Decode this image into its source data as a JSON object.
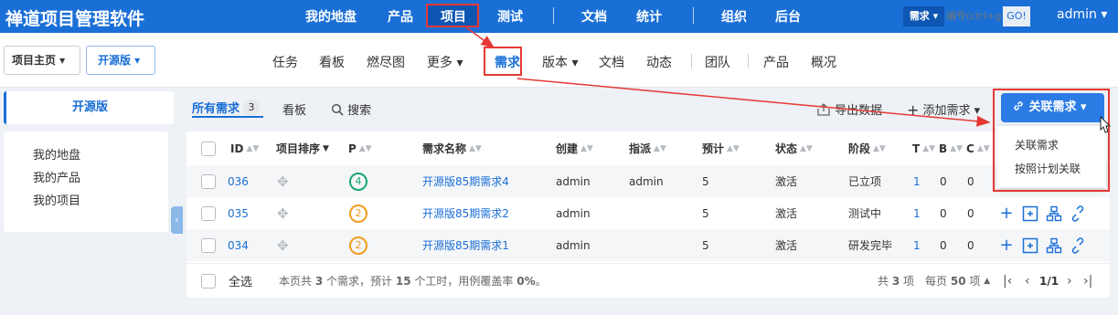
{
  "topbar": {
    "brand": "禅道项目管理软件",
    "nav": [
      {
        "label": "我的地盘"
      },
      {
        "label": "产品"
      },
      {
        "label": "项目"
      },
      {
        "label": "测试"
      },
      {
        "label": "文档"
      },
      {
        "label": "统计"
      },
      {
        "label": "组织"
      },
      {
        "label": "后台"
      }
    ],
    "search_type": "需求 ▾",
    "search_placeholder": "编号(ctrl+g)",
    "search_go": "GO!",
    "user": "admin ▾"
  },
  "subbar": {
    "crumb_home": "项目主页 ▾",
    "crumb_version": "开源版 ▾",
    "items": [
      {
        "label": "任务"
      },
      {
        "label": "看板"
      },
      {
        "label": "燃尽图"
      },
      {
        "label": "更多 ▾"
      },
      {
        "label": "需求"
      },
      {
        "label": "版本 ▾"
      },
      {
        "label": "文档"
      },
      {
        "label": "动态"
      },
      {
        "label": "团队"
      },
      {
        "label": "产品"
      },
      {
        "label": "概况"
      }
    ]
  },
  "sidebar": {
    "title": "开源版",
    "links": [
      {
        "label": "我的地盘"
      },
      {
        "label": "我的产品"
      },
      {
        "label": "我的项目"
      }
    ]
  },
  "toolbar": {
    "tab_all": "所有需求",
    "tab_all_count": "3",
    "tab_kanban": "看板",
    "tab_search": "搜索",
    "export": "导出数据",
    "add": "添加需求 ▾",
    "link_story": "关联需求 ▾"
  },
  "table": {
    "headers": {
      "id": "ID",
      "order": "项目排序",
      "pri": "P",
      "name": "需求名称",
      "creator": "创建",
      "assigned": "指派",
      "estimate": "预计",
      "status": "状态",
      "stage": "阶段",
      "t": "T",
      "b": "B",
      "c": "C"
    },
    "rows": [
      {
        "id": "036",
        "pri": "4",
        "name": "开源版85期需求4",
        "creator": "admin",
        "assigned": "admin",
        "estimate": "5",
        "status": "激活",
        "stage": "已立项",
        "t": "1",
        "b": "0",
        "c": "0"
      },
      {
        "id": "035",
        "pri": "2",
        "name": "开源版85期需求2",
        "creator": "admin",
        "assigned": "",
        "estimate": "5",
        "status": "激活",
        "stage": "测试中",
        "t": "1",
        "b": "0",
        "c": "0"
      },
      {
        "id": "034",
        "pri": "2",
        "name": "开源版85期需求1",
        "creator": "admin",
        "assigned": "",
        "estimate": "5",
        "status": "激活",
        "stage": "研发完毕",
        "t": "1",
        "b": "0",
        "c": "0"
      }
    ],
    "footer": {
      "select_all": "全选",
      "summary_prefix": "本页共",
      "summary_count": "3",
      "summary_mid": "个需求，预计",
      "summary_hours": "15",
      "summary_mid2": "个工时，用例覆盖率",
      "summary_rate": "0%",
      "summary_end": "。",
      "total_prefix": "共",
      "total_count": "3",
      "total_suffix": "项",
      "per_page_prefix": "每页",
      "per_page": "50",
      "per_page_suffix": "项",
      "page": "1/1"
    }
  },
  "dropdown": {
    "items": [
      {
        "label": "关联需求"
      },
      {
        "label": "按照计划关联"
      }
    ]
  },
  "colors": {
    "brand_blue": "#1a6fd6",
    "annotation_red": "#e53935",
    "pri_4": "#17a673",
    "pri_2": "#f29b1d"
  }
}
